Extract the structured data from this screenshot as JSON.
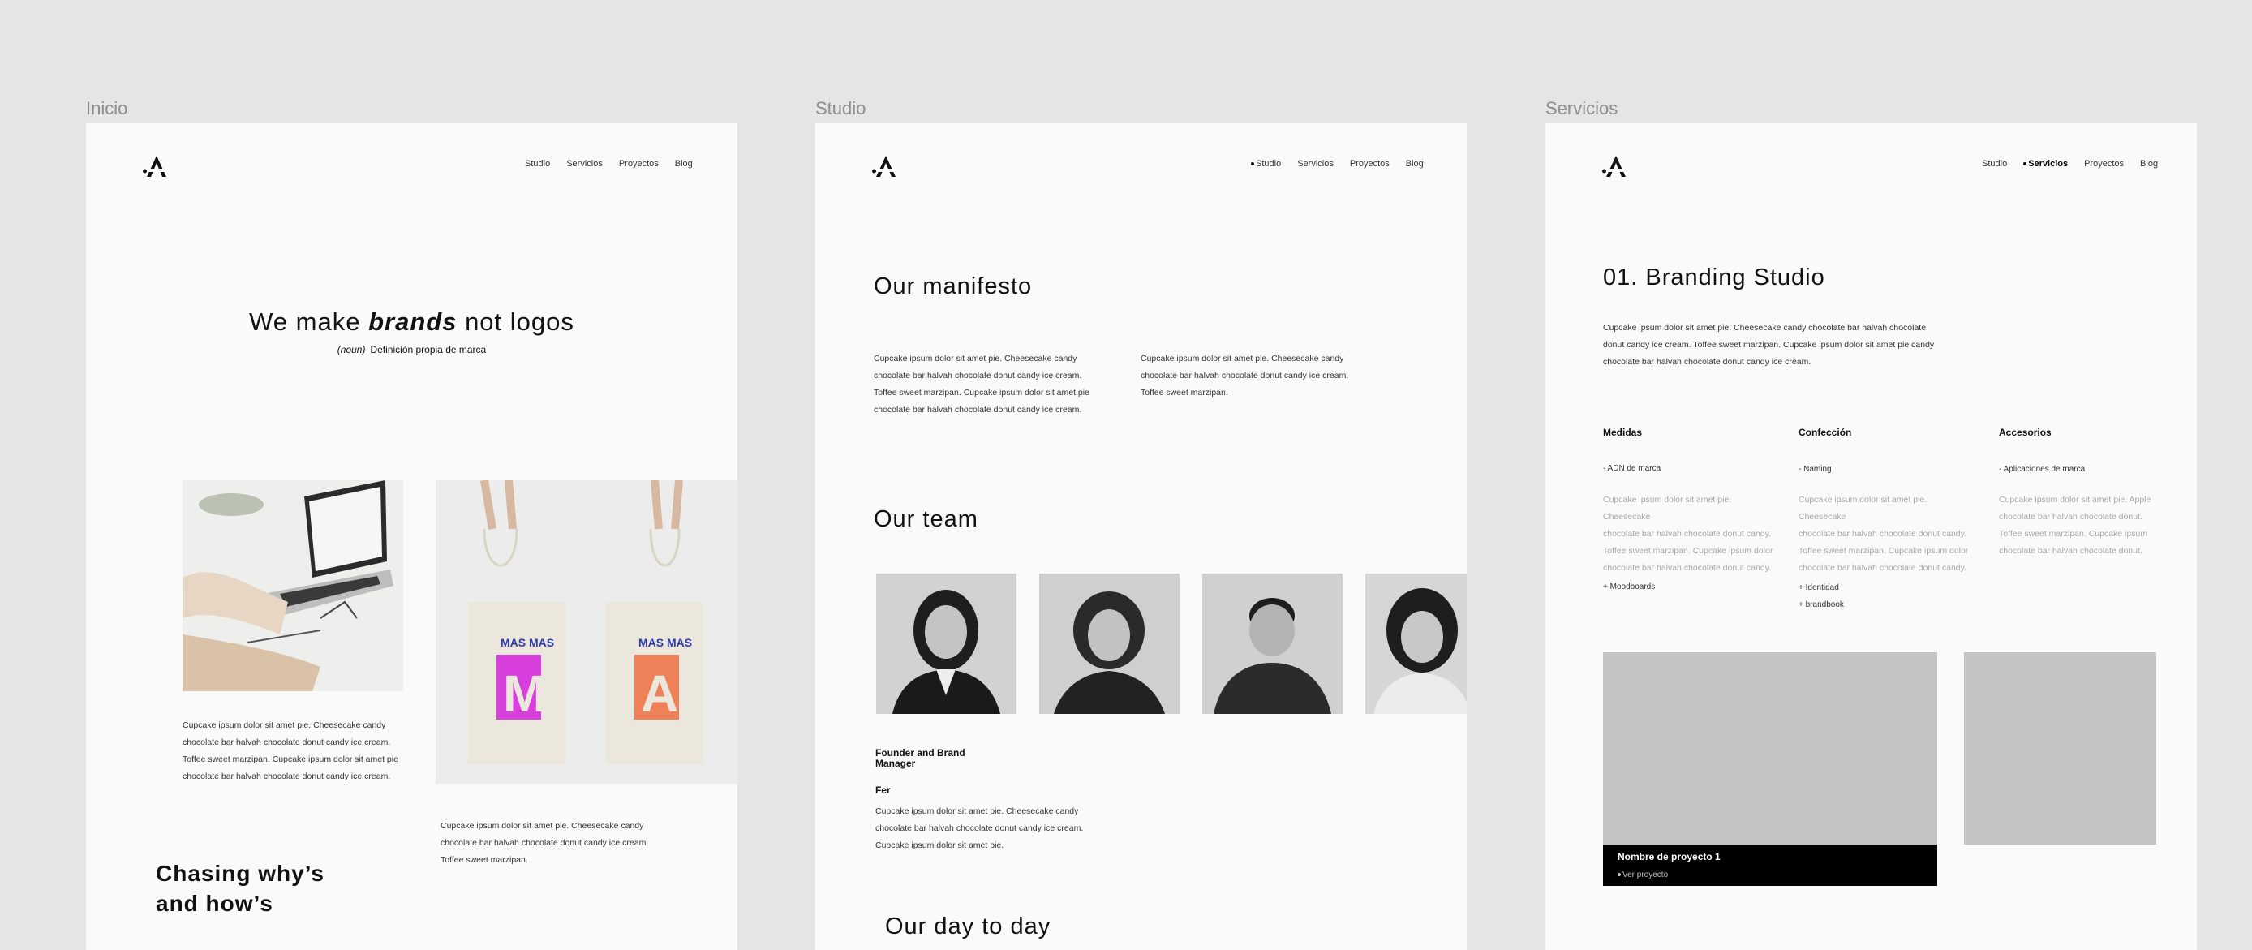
{
  "frames": [
    {
      "label": "Inicio"
    },
    {
      "label": "Studio"
    },
    {
      "label": "Servicios"
    }
  ],
  "nav": {
    "studio": "Studio",
    "servicios": "Servicios",
    "proyectos": "Proyectos",
    "blog": "Blog"
  },
  "inicio": {
    "hero_pre": "We make ",
    "hero_bold": "brands",
    "hero_post": " not logos",
    "noun": "(noun)",
    "definition": "Definición propia de marca",
    "text_1": [
      "Cupcake ipsum dolor sit amet pie. Cheesecake candy",
      "chocolate bar halvah chocolate donut candy ice cream.",
      "Toffee sweet marzipan. Cupcake ipsum dolor sit amet pie",
      "chocolate bar halvah chocolate donut candy ice cream."
    ],
    "text_2": [
      "Cupcake ipsum dolor sit amet pie. Cheesecake candy",
      "chocolate bar halvah chocolate donut candy ice cream.",
      "Toffee sweet marzipan."
    ],
    "chasing_1": "Chasing why’s",
    "chasing_2": "and how’s",
    "bag_1_letter": "M",
    "bag_2_letter": "A",
    "bag_print": "MAS MAS"
  },
  "studio": {
    "manifesto_title": "Our manifesto",
    "manifesto_1": [
      "Cupcake ipsum dolor sit amet pie. Cheesecake candy",
      "chocolate bar halvah chocolate donut candy ice cream.",
      "Toffee sweet marzipan. Cupcake ipsum dolor sit amet pie",
      "chocolate bar halvah chocolate donut candy ice cream."
    ],
    "manifesto_2": [
      "Cupcake ipsum dolor sit amet pie. Cheesecake candy",
      "chocolate bar halvah chocolate donut candy ice cream.",
      "Toffee sweet marzipan."
    ],
    "team_title": "Our team",
    "role": "Founder and Brand Manager",
    "name": "Fer",
    "bio": [
      "Cupcake ipsum dolor sit amet pie. Cheesecake candy",
      "chocolate bar halvah chocolate donut candy ice cream.",
      "Cupcake ipsum dolor sit amet pie."
    ],
    "day_title": "Our day to day"
  },
  "servicios": {
    "title": "01. Branding Studio",
    "intro": [
      "Cupcake ipsum dolor sit amet pie. Cheesecake candy chocolate bar halvah chocolate",
      "donut candy ice cream. Toffee sweet marzipan. Cupcake ipsum dolor sit amet pie candy",
      "chocolate bar halvah chocolate donut candy ice cream."
    ],
    "columns": [
      {
        "head": "Medidas",
        "item": "- ADN de marca",
        "body": [
          "Cupcake ipsum dolor sit amet pie. Cheesecake",
          "chocolate bar halvah chocolate donut candy.",
          "Toffee sweet marzipan. Cupcake ipsum dolor",
          "chocolate bar halvah chocolate donut candy."
        ],
        "extras": [
          "+ Moodboards"
        ]
      },
      {
        "head": "Confección",
        "item": "- Naming",
        "body": [
          "Cupcake ipsum dolor sit amet pie. Cheesecake",
          "chocolate bar halvah chocolate donut candy.",
          "Toffee sweet marzipan. Cupcake ipsum dolor",
          "chocolate bar halvah chocolate donut candy."
        ],
        "extras": [
          "+ Identidad",
          "+ brandbook"
        ]
      },
      {
        "head": "Accesorios",
        "item": "- Aplicaciones de marca",
        "body": [
          "Cupcake ipsum dolor sit amet pie. Apple",
          "chocolate bar halvah chocolate donut.",
          "Toffee sweet marzipan. Cupcake ipsum",
          "chocolate bar halvah chocolate donut."
        ],
        "extras": []
      }
    ],
    "project_name": "Nombre de proyecto 1",
    "project_link": "Ver proyecto"
  }
}
